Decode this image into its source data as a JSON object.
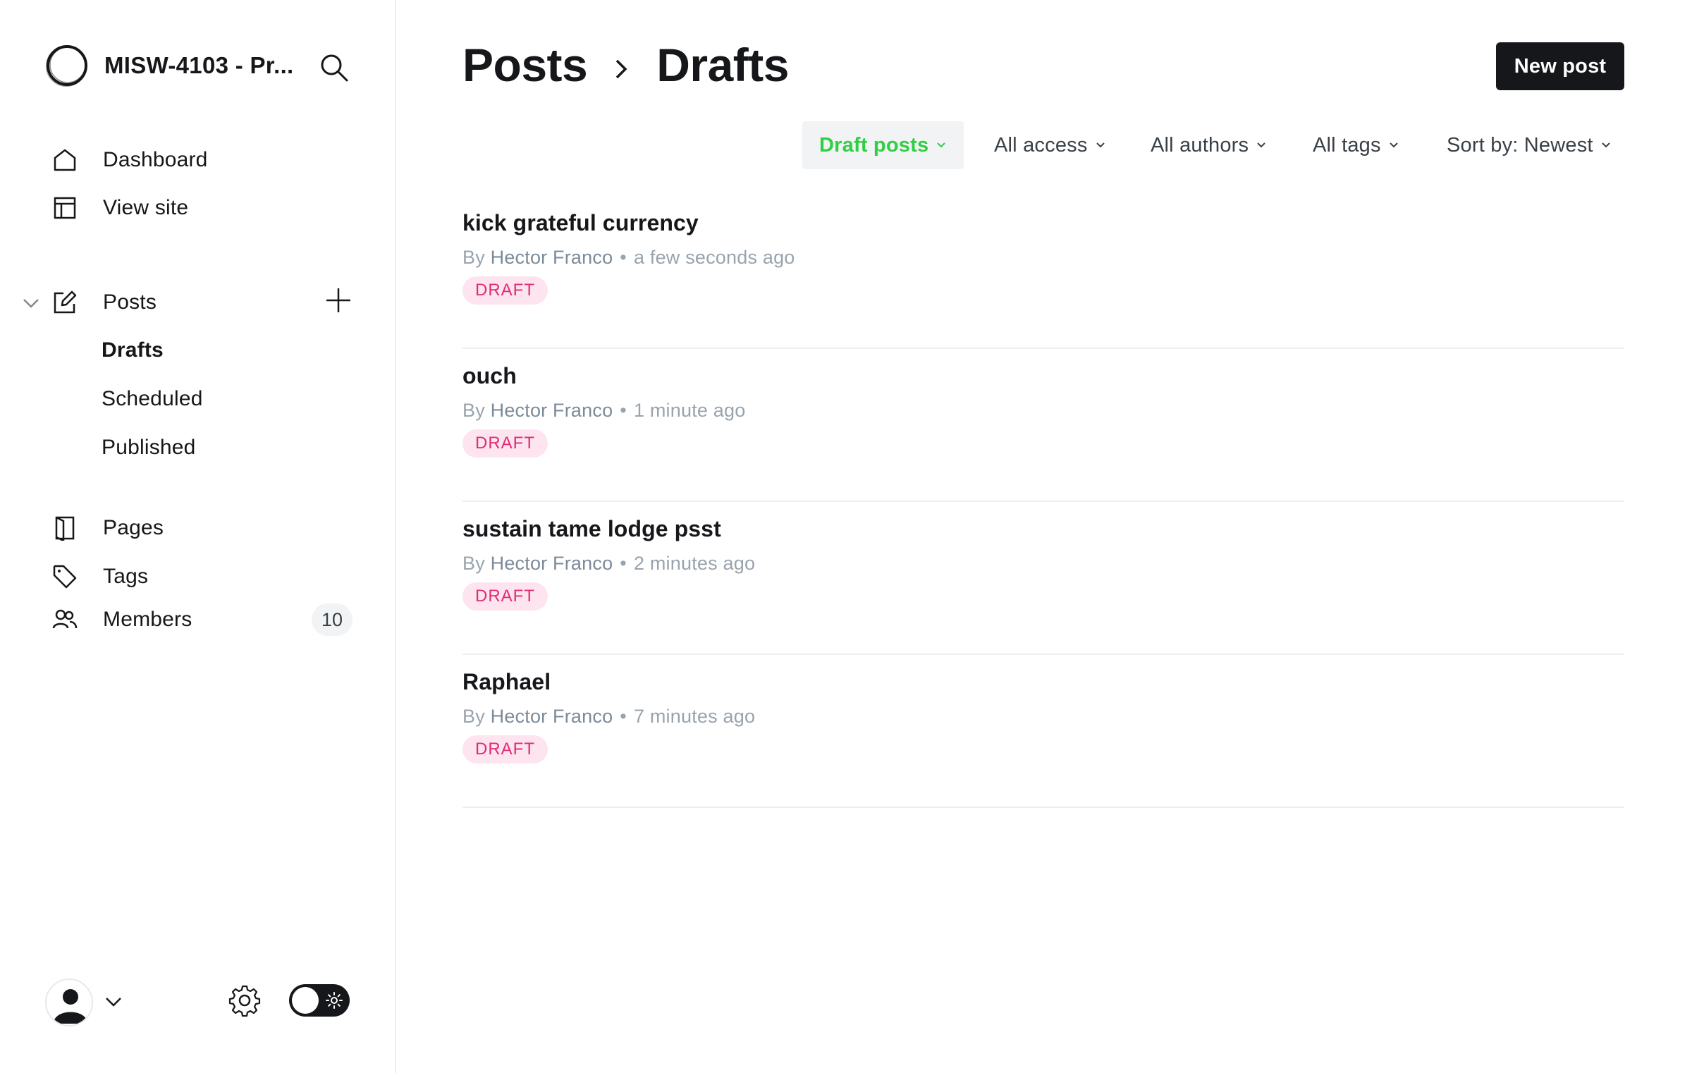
{
  "sidebar": {
    "site_name": "MISW-4103 - Pr...",
    "nav": {
      "dashboard": "Dashboard",
      "view_site": "View site",
      "posts": "Posts",
      "drafts": "Drafts",
      "scheduled": "Scheduled",
      "published": "Published",
      "pages": "Pages",
      "tags": "Tags",
      "members": "Members",
      "members_count": "10"
    }
  },
  "header": {
    "breadcrumb_parent": "Posts",
    "breadcrumb_current": "Drafts",
    "new_post_label": "New post"
  },
  "filters": {
    "type": "Draft posts",
    "access": "All access",
    "authors": "All authors",
    "tags": "All tags",
    "sort": "Sort by: Newest"
  },
  "posts": [
    {
      "title": "kick grateful currency",
      "by": "By",
      "author": "Hector Franco",
      "time": "a few seconds ago",
      "status": "DRAFT"
    },
    {
      "title": "ouch",
      "by": "By",
      "author": "Hector Franco",
      "time": "1 minute ago",
      "status": "DRAFT"
    },
    {
      "title": "sustain tame lodge psst",
      "by": "By",
      "author": "Hector Franco",
      "time": "2 minutes ago",
      "status": "DRAFT"
    },
    {
      "title": "Raphael",
      "by": "By",
      "author": "Hector Franco",
      "time": "7 minutes ago",
      "status": "DRAFT"
    }
  ],
  "colors": {
    "accent_green": "#30cf43",
    "draft_pink": "#e02c74",
    "primary_dark": "#15171a"
  }
}
